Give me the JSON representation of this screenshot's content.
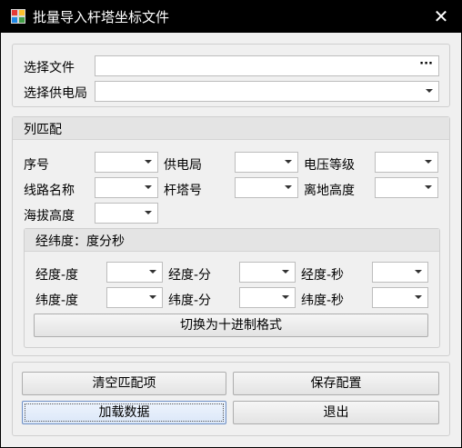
{
  "window": {
    "title": "批量导入杆塔坐标文件",
    "close_glyph": "✕"
  },
  "file_panel": {
    "file_label": "选择文件",
    "file_value": "",
    "browse_glyph": "···",
    "bureau_label": "选择供电局",
    "bureau_value": ""
  },
  "columns_panel": {
    "title": "列匹配",
    "fields": {
      "seq": "序号",
      "bureau": "供电局",
      "voltage": "电压等级",
      "line_name": "线路名称",
      "tower_no": "杆塔号",
      "ground_height": "离地高度",
      "altitude": "海拔高度"
    },
    "dms_panel": {
      "title": "经纬度：度分秒",
      "lon_deg": "经度-度",
      "lon_min": "经度-分",
      "lon_sec": "经度-秒",
      "lat_deg": "纬度-度",
      "lat_min": "纬度-分",
      "lat_sec": "纬度-秒",
      "switch_button": "切换为十进制格式"
    }
  },
  "actions": {
    "clear": "清空匹配项",
    "save": "保存配置",
    "load": "加载数据",
    "exit": "退出"
  }
}
